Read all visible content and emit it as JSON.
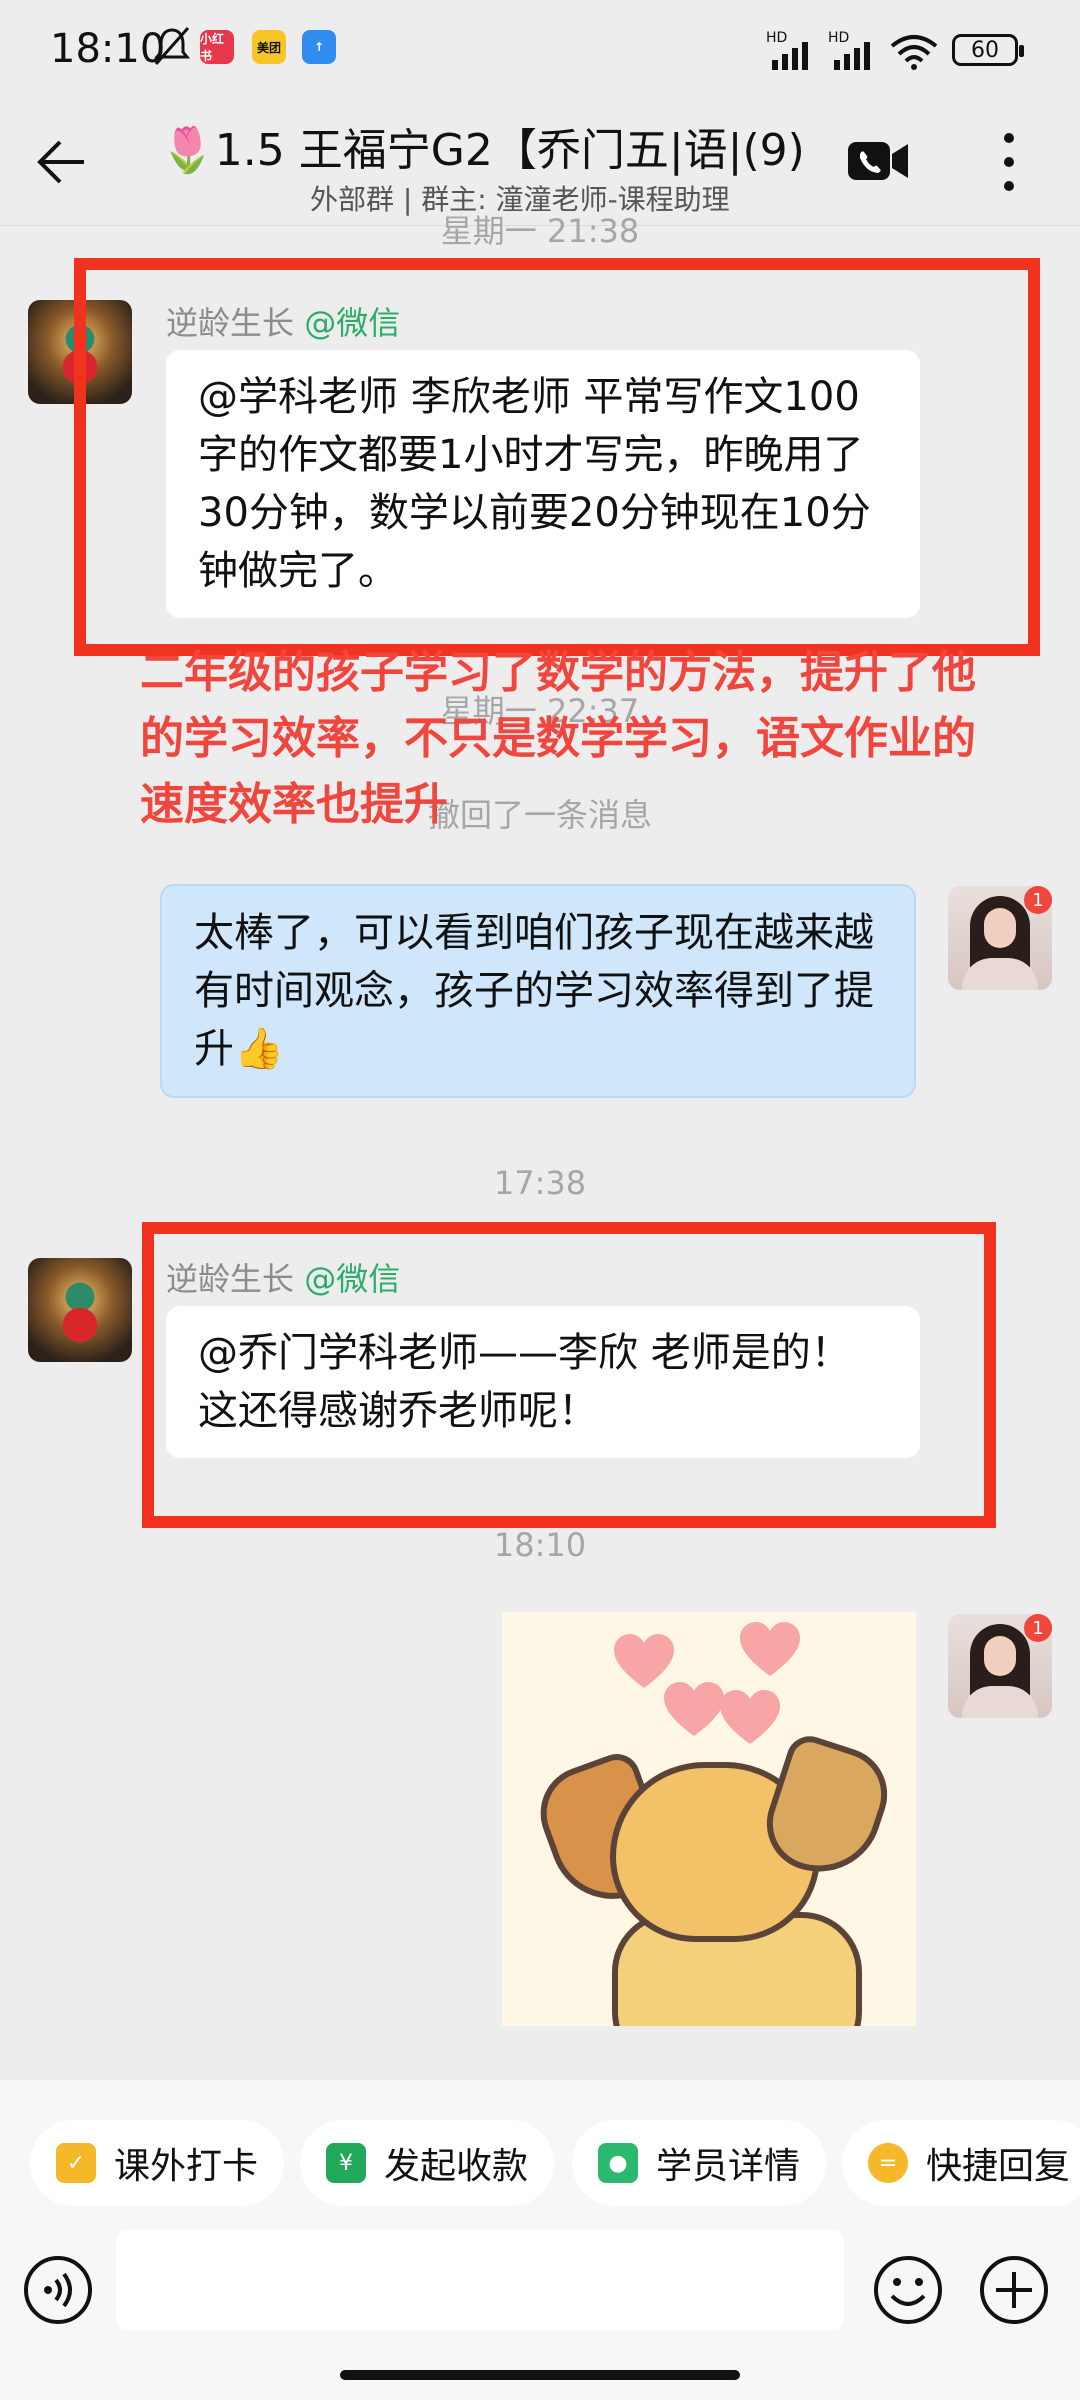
{
  "status_bar": {
    "time": "18:10",
    "apps": [
      "小红书",
      "美团",
      "↑"
    ],
    "signal_labels": [
      "HD",
      "HD"
    ],
    "battery": "60"
  },
  "header": {
    "title": "🌷1.5 王福宁G2【乔门五|语|(9)",
    "subtitle": "外部群 | 群主: 潼潼老师-课程助理"
  },
  "messages": [
    {
      "type": "time",
      "text": "星期一 21:38"
    },
    {
      "type": "incoming",
      "sender": "逆龄生长",
      "source": "@微信",
      "text": "@学科老师 李欣老师 平常写作文100字的作文都要1小时才写完，昨晚用了30分钟，数学以前要20分钟现在10分钟做完了。"
    },
    {
      "type": "time",
      "text": "星期一 22:37"
    },
    {
      "type": "system",
      "text": "撤回了一条消息"
    },
    {
      "type": "outgoing",
      "text": "太棒了，可以看到咱们孩子现在越来越有时间观念，孩子的学习效率得到了提升👍",
      "badge": "1"
    },
    {
      "type": "time",
      "text": "17:38"
    },
    {
      "type": "incoming",
      "sender": "逆龄生长",
      "source": "@微信",
      "text": "@乔门学科老师——李欣 老师是的！这还得感谢乔老师呢！"
    },
    {
      "type": "time",
      "text": "18:10"
    },
    {
      "type": "outgoing-sticker",
      "badge": "1"
    }
  ],
  "annotation": "二年级的孩子学习了数学的方法，提升了他的学习效率，不只是数学学习，语文作业的速度效率也提升",
  "quick_actions": [
    "课外打卡",
    "发起收款",
    "学员详情",
    "快捷回复"
  ],
  "input": {
    "placeholder": ""
  },
  "colors": {
    "accent_red": "#f0321f",
    "annotation_red": "#f0463e",
    "wechat_green": "#2aae67",
    "bubble_blue": "#cfe6fb"
  }
}
